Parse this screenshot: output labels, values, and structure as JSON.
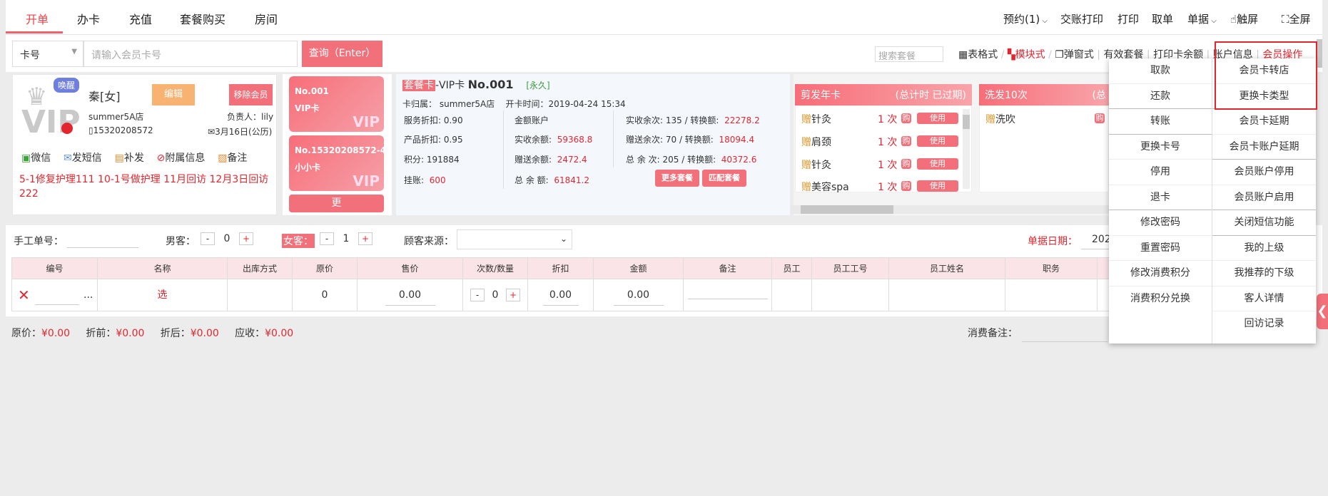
{
  "tabs": [
    "开单",
    "办卡",
    "充值",
    "套餐购买",
    "房间"
  ],
  "top_right": {
    "appointment": "预约(1)",
    "shift_print": "交账打印",
    "print": "打印",
    "take_order": "取单",
    "docs": "单据",
    "touch": "触屏",
    "fullscreen": "全屏"
  },
  "search": {
    "select_value": "卡号",
    "placeholder": "请输入会员卡号",
    "query_button": "查询（Enter）"
  },
  "package_search_placeholder": "搜索套餐",
  "view_links": [
    "表格式",
    "模块式",
    "弹窗式",
    "有效套餐",
    "打印卡余额",
    "账户信息",
    "会员操作"
  ],
  "member": {
    "badge": "唤醒",
    "vip_text": "VIP",
    "name": "秦[女]",
    "edit": "编辑",
    "remove": "移除会员",
    "store": "summer5A店",
    "owner_label": "负责人：",
    "owner": "lily",
    "phone": "15320208572",
    "birthday": "3月16日(公历)",
    "actions": [
      "微信",
      "发短信",
      "补发",
      "附属信息",
      "备注"
    ],
    "notes": "5-1修复护理111  10-1号做护理  11月回访  12月3日回访  222"
  },
  "cards": [
    {
      "no": "No.001",
      "type": "VIP卡",
      "mark": "VIP"
    },
    {
      "no": "No.15320208572-4",
      "type": "小小卡",
      "mark": "VIP"
    }
  ],
  "more_label": "更",
  "card_info": {
    "tag": "套餐卡",
    "type": "-VIP卡",
    "no": "No.001",
    "validity": "[永久]",
    "belong_label": "卡归属：",
    "belong": "summer5A店",
    "open_label": "开卡时间：",
    "open_time": "2019-04-24 15:34",
    "service_discount": "服务折扣: 0.90",
    "product_discount": "产品折扣: 0.95",
    "points": "积分: 191884",
    "hang_label": "挂账:",
    "hang": "600",
    "money_account": "金额账户",
    "actual_balance_label": "实收余额:",
    "actual_balance": "59368.8",
    "gift_balance_label": "赠送余额:",
    "gift_balance": "2472.4",
    "total_balance_label": "总 余 额:",
    "total_balance": "61841.2",
    "actual_times": "实收余次: 135 / 转换额:",
    "actual_times_val": "22278.2",
    "gift_times": "赠送余次: 70  / 转换额:",
    "gift_times_val": "18094.4",
    "total_times": "总 余 次: 205 / 转换额:",
    "total_times_val": "40372.6",
    "more_pkg": "更多套餐",
    "match_pkg": "匹配套餐"
  },
  "package1": {
    "title": "剪发年卡",
    "note": "(总计时 已过期)",
    "items": [
      {
        "name": "针灸",
        "count": "1 次"
      },
      {
        "name": "肩颈",
        "count": "1 次"
      },
      {
        "name": "针灸",
        "count": "1 次"
      },
      {
        "name": "美容spa",
        "count": "1 次"
      }
    ],
    "buy": "购",
    "use": "使用",
    "icon": "赠"
  },
  "package2": {
    "title": "洗发10次",
    "note": "(总",
    "items": [
      {
        "name": "洗吹"
      }
    ],
    "buy": "购",
    "use": "使"
  },
  "form": {
    "manual_no": "手工单号：",
    "male": "男客：",
    "male_count": "0",
    "female": "女客：",
    "female_count": "1",
    "source": "顾客来源：",
    "date_label": "单据日期：",
    "date_val": "202"
  },
  "table": {
    "headers": [
      "编号",
      "名称",
      "出库方式",
      "原价",
      "售价",
      "次数/数量",
      "折扣",
      "金额",
      "备注",
      "员工",
      "员工工号",
      "员工姓名",
      "职务"
    ],
    "row": {
      "select": "选",
      "dots": "...",
      "orig": "0",
      "price": "0.00",
      "qty": "0",
      "discount": "0.00",
      "amount": "0.00"
    }
  },
  "summary": {
    "orig": "原价：",
    "orig_v": "¥0.00",
    "before": "折前：",
    "before_v": "¥0.00",
    "after": "折后：",
    "after_v": "¥0.00",
    "due": "应收：",
    "due_v": "¥0.00",
    "remark": "消费备注："
  },
  "menu": {
    "left": [
      "取款",
      "还款",
      "转账",
      "更换卡号",
      "停用",
      "退卡",
      "修改密码",
      "重置密码",
      "修改消费积分",
      "消费积分兑换"
    ],
    "right": [
      "会员卡转店",
      "更换卡类型",
      "会员卡延期",
      "会员卡账户延期",
      "会员账户停用",
      "会员账户启用",
      "关闭短信功能",
      "我的上级",
      "我推荐的下级",
      "客人详情",
      "回访记录"
    ]
  },
  "colors": {
    "accent": "#e3262e",
    "pink": "#f2707a"
  }
}
